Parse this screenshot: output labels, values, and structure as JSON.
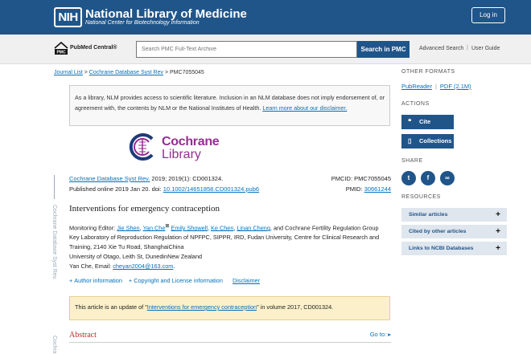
{
  "header": {
    "nih_logo": "NIH",
    "title": "National Library of Medicine",
    "subtitle": "National Center for Biotechnology Information",
    "login_label": "Log in"
  },
  "searchbar": {
    "pmc_logo": "PMC",
    "pmc_name": "PubMed Central®",
    "placeholder": "Search PMC Full-Text Archive",
    "button": "Search in PMC",
    "advanced": "Advanced Search",
    "separator": "|",
    "guide": "User Guide"
  },
  "breadcrumb": {
    "items": [
      "Journal List",
      "Cochrane Database Syst Rev",
      "PMC7055045"
    ],
    "sep": ">"
  },
  "notice": {
    "text": "As a library, NLM provides access to scientific literature. Inclusion in an NLM database does not imply endorsement of, or agreement with, the contents by NLM or the National Institutes of Health. ",
    "link": "Learn more about our disclaimer."
  },
  "journal_logo": {
    "line1": "Cochrane",
    "line2": "Library"
  },
  "citation": {
    "journal": "Cochrane Database Syst Rev.",
    "details": " 2019; 2019(1): CD001324.",
    "published": "Published online 2019 Jan 20. doi: ",
    "doi": "10.1002/14651858.CD001324.pub6",
    "pmcid": "PMCID: PMC7055045",
    "pmid_label": "PMID: ",
    "pmid": "30661244"
  },
  "article": {
    "title": "Interventions for emergency contraception",
    "editor_label": "Monitoring Editor: ",
    "authors": [
      "Jie Shen",
      "Yan Che",
      "Emily Showell",
      "Ke Chen",
      "Linan Cheng"
    ],
    "author_sup": "⊠",
    "group": ", and Cochrane Fertility Regulation Group",
    "affil1": "Key Laboratory of Reproduction Regulation of NPFPC, SIPPR, IRD, Fudan University, Centre for Clinical Research and Training, 2140 Xie Tu Road, ShanghaiChina",
    "affil2": "University of Otago, Leith St, DunedinNew Zealand",
    "contact": "Yan Che, Email: ",
    "email": "cheyan2004@163.com",
    "email_tail": "."
  },
  "meta_links": [
    "Author information",
    "Copyright and License information",
    "Disclaimer"
  ],
  "update_notice": {
    "pre": "This article is an update of \"",
    "link": "Interventions for emergency contraception",
    "post": "\" in volume 2017, CD001324."
  },
  "section": {
    "abstract": "Abstract",
    "goto": "Go to: ▸"
  },
  "side_vertical": {
    "text1": "Cochrane Database Syst Rev.",
    "text2": "Cochra"
  },
  "sidebar": {
    "other_formats": "OTHER FORMATS",
    "pubreader": "PubReader",
    "pdf": "PDF (2.1M)",
    "actions": "ACTIONS",
    "cite": "Cite",
    "collections": "Collections",
    "share": "SHARE",
    "resources": "RESOURCES",
    "resource_items": [
      "Similar articles",
      "Cited by other articles",
      "Links to NCBI Databases"
    ]
  },
  "colors": {
    "header_bg": "#20558a",
    "link": "#0071bc",
    "cochrane": "#962d91",
    "abstract": "#b82b2b"
  }
}
